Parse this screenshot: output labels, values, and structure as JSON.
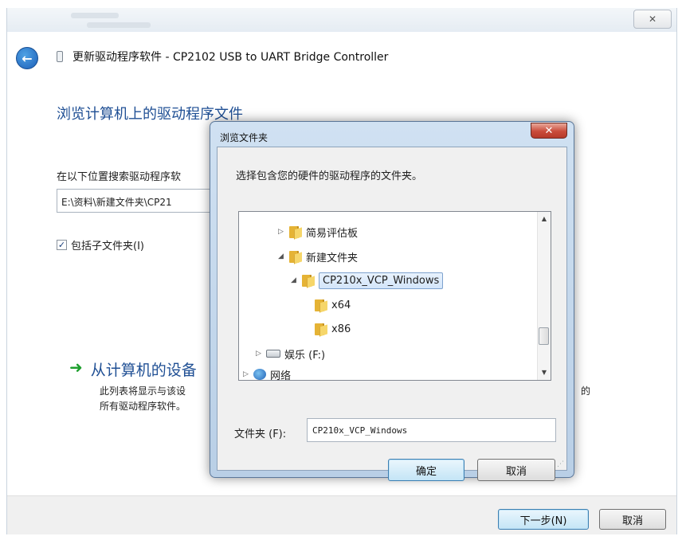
{
  "wizard": {
    "title": "更新驱动程序软件 - CP2102 USB to UART Bridge Controller",
    "close_glyph": "✕",
    "back_glyph": "←",
    "heading": "浏览计算机上的驱动程序文件",
    "search_label": "在以下位置搜索驱动程序软",
    "path_value": "E:\\资料\\新建文件夹\\CP21",
    "include_subfolders": {
      "label": "包括子文件夹(I)",
      "checked": true,
      "check_glyph": "✓"
    },
    "pick_link": {
      "arrow": "➜",
      "title": "从计算机的设备",
      "desc_line1": "此列表将显示与该设",
      "desc_tail": "的",
      "desc_line2": "所有驱动程序软件。"
    },
    "footer": {
      "next_label": "下一步(N)",
      "cancel_label": "取消"
    }
  },
  "browse_dialog": {
    "title": "浏览文件夹",
    "close_glyph": "✕",
    "description": "选择包含您的硬件的驱动程序的文件夹。",
    "tree": [
      {
        "label": "简易评估板",
        "expander": "▷",
        "icon": "folder-icon",
        "selected": false
      },
      {
        "label": "新建文件夹",
        "expander": "◢",
        "icon": "folder-icon",
        "selected": false
      },
      {
        "label": "CP210x_VCP_Windows",
        "expander": "◢",
        "icon": "folder-icon",
        "selected": true
      },
      {
        "label": "x64",
        "expander": "",
        "icon": "folder-icon",
        "selected": false
      },
      {
        "label": "x86",
        "expander": "",
        "icon": "folder-icon",
        "selected": false
      },
      {
        "label": "娱乐 (F:)",
        "expander": "▷",
        "icon": "drive-icon",
        "selected": false
      },
      {
        "label": "网络",
        "expander": "▷",
        "icon": "network-icon",
        "selected": false
      }
    ],
    "scroll_up": "▲",
    "scroll_down": "▼",
    "folder_label": "文件夹 (F):",
    "folder_value": "CP210x_VCP_Windows",
    "ok_label": "确定",
    "cancel_label": "取消"
  }
}
